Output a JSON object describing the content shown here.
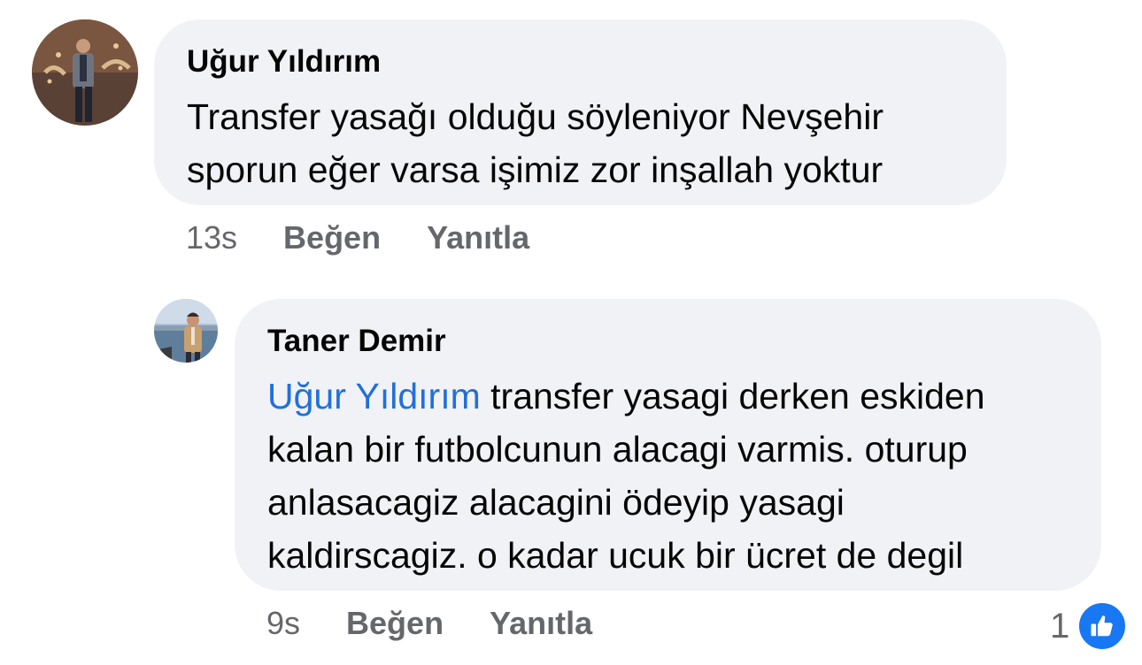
{
  "comments": [
    {
      "author": "Uğur Yıldırım",
      "avatar": "profile-photo-man-in-suit",
      "text_lines": [
        "Transfer yasağı olduğu söyleniyor  Nevşehir",
        "sporun eğer varsa işimiz zor inşallah yoktur"
      ],
      "time": "13s",
      "like_label": "Beğen",
      "reply_label": "Yanıtla"
    },
    {
      "author": "Taner Demir",
      "avatar": "profile-photo-man-by-water",
      "mention": "Uğur Yıldırım",
      "text_first_line_rest": " transfer yasagi derken eskiden",
      "text_lines": [
        "kalan bir futbolcunun alacagi varmis. oturup",
        "anlasacagiz alacagini ödeyip yasagi",
        "kaldirscagiz. o kadar ucuk bir ücret de degil"
      ],
      "time": "9s",
      "like_label": "Beğen",
      "reply_label": "Yanıtla",
      "reaction_count": "1",
      "reaction_icon": "thumbs-up-icon"
    }
  ],
  "colors": {
    "bubble_bg": "#f0f2f5",
    "mention": "#216fdb",
    "meta_text": "#65676b",
    "like_badge": "#1877f2"
  }
}
